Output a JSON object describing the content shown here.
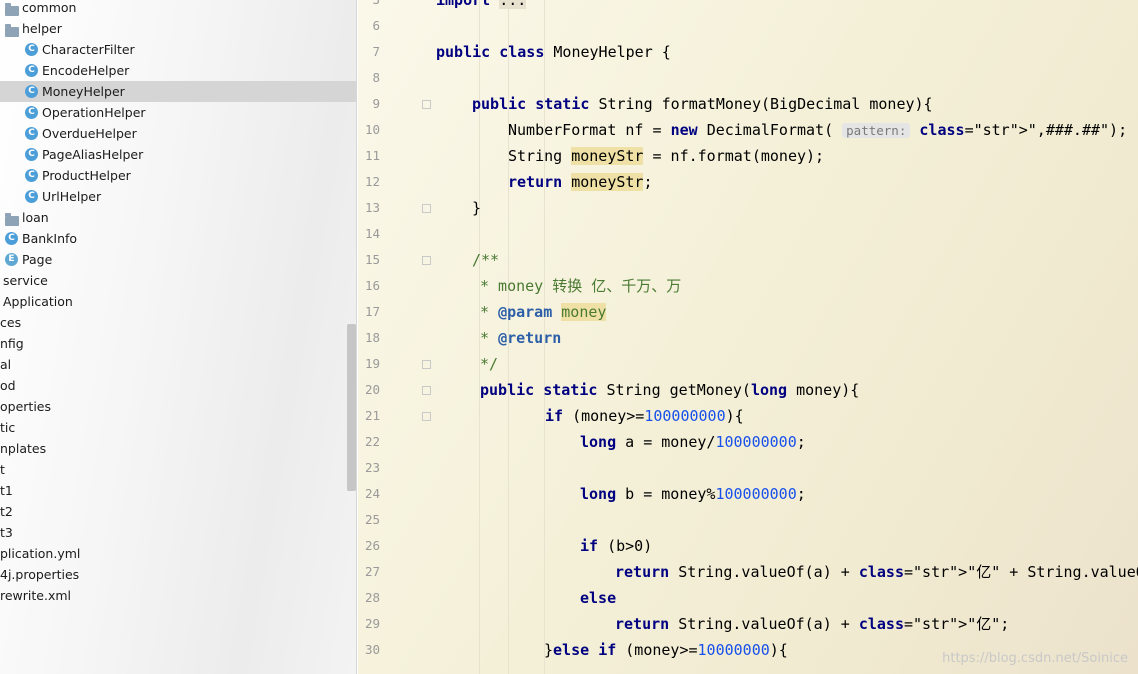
{
  "tree": {
    "items": [
      {
        "type": "folder",
        "label": "common"
      },
      {
        "type": "folder",
        "label": "helper"
      },
      {
        "type": "class",
        "label": "CharacterFilter"
      },
      {
        "type": "class",
        "label": "EncodeHelper"
      },
      {
        "type": "class",
        "label": "MoneyHelper",
        "selected": true
      },
      {
        "type": "class",
        "label": "OperationHelper"
      },
      {
        "type": "class",
        "label": "OverdueHelper"
      },
      {
        "type": "class",
        "label": "PageAliasHelper"
      },
      {
        "type": "class",
        "label": "ProductHelper"
      },
      {
        "type": "class",
        "label": "UrlHelper"
      },
      {
        "type": "folder",
        "label": "loan"
      },
      {
        "type": "class",
        "label": "BankInfo"
      },
      {
        "type": "enum",
        "label": "Page"
      },
      {
        "type": "text",
        "label": "service"
      },
      {
        "type": "text",
        "label": "Application"
      },
      {
        "type": "text",
        "label": "ces"
      },
      {
        "type": "text",
        "label": "nfig"
      },
      {
        "type": "text",
        "label": "al"
      },
      {
        "type": "text",
        "label": "od"
      },
      {
        "type": "text",
        "label": "operties"
      },
      {
        "type": "text",
        "label": "tic"
      },
      {
        "type": "text",
        "label": "nplates"
      },
      {
        "type": "text",
        "label": "t"
      },
      {
        "type": "text",
        "label": "t1"
      },
      {
        "type": "text",
        "label": "t2"
      },
      {
        "type": "text",
        "label": "t3"
      },
      {
        "type": "text",
        "label": "plication.yml"
      },
      {
        "type": "text",
        "label": "4j.properties"
      },
      {
        "type": "text",
        "label": "rewrite.xml"
      }
    ]
  },
  "editor": {
    "lines": [
      {
        "num": "3",
        "code": "import ..."
      },
      {
        "num": "6",
        "code": ""
      },
      {
        "num": "7",
        "code": "public class MoneyHelper {"
      },
      {
        "num": "8",
        "code": ""
      },
      {
        "num": "9",
        "code": "public static String formatMoney(BigDecimal money){"
      },
      {
        "num": "10",
        "code": "NumberFormat nf = new DecimalFormat( pattern: \",###.##\");"
      },
      {
        "num": "11",
        "code": "String moneyStr = nf.format(money);"
      },
      {
        "num": "12",
        "code": "return moneyStr;"
      },
      {
        "num": "13",
        "code": "}"
      },
      {
        "num": "14",
        "code": ""
      },
      {
        "num": "15",
        "code": "/**"
      },
      {
        "num": "16",
        "code": "* money 转换 亿、千万、万"
      },
      {
        "num": "17",
        "code": "* @param money"
      },
      {
        "num": "18",
        "code": "* @return"
      },
      {
        "num": "19",
        "code": "*/"
      },
      {
        "num": "20",
        "code": "public static String getMoney(long money){"
      },
      {
        "num": "21",
        "code": "if (money>=100000000){"
      },
      {
        "num": "22",
        "code": "long a = money/100000000;"
      },
      {
        "num": "23",
        "code": ""
      },
      {
        "num": "24",
        "code": "long b = money%100000000;"
      },
      {
        "num": "25",
        "code": ""
      },
      {
        "num": "26",
        "code": "if (b>0)"
      },
      {
        "num": "27",
        "code": "return String.valueOf(a) + \"亿\" + String.valueOf(b);"
      },
      {
        "num": "28",
        "code": "else"
      },
      {
        "num": "29",
        "code": "return String.valueOf(a) + \"亿\";"
      },
      {
        "num": "30",
        "code": "}else if (money>=10000000){"
      }
    ]
  },
  "watermark": "https://blog.csdn.net/Soinice",
  "colors": {
    "keyword": "#000080",
    "string": "#067d17",
    "number": "#1750eb",
    "javadoc": "#4a7a32",
    "selection": "#d5d5d5"
  }
}
